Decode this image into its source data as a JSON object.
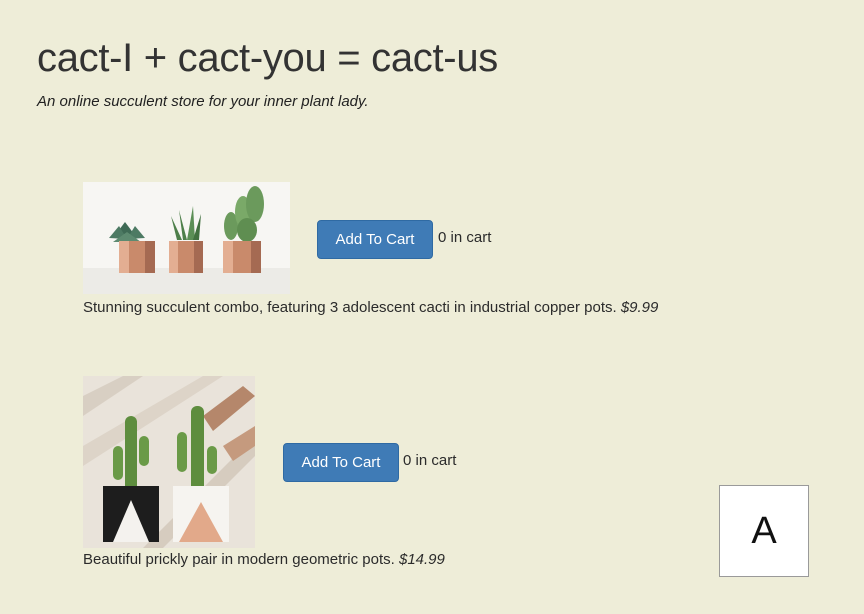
{
  "header": {
    "title": "cact-I + cact-you = cact-us",
    "tagline": "An online succulent store for your inner plant lady."
  },
  "products": [
    {
      "image_icon": "three-cacti-copper-pots-image",
      "button_label": "Add To Cart",
      "cart_count": "0 in cart",
      "description": "Stunning succulent combo, featuring 3 adolescent cacti in industrial copper pots.",
      "price": "$9.99"
    },
    {
      "image_icon": "two-cacti-geometric-pots-image",
      "button_label": "Add To Cart",
      "cart_count": "0 in cart",
      "description": "Beautiful prickly pair in modern geometric pots.",
      "price": "$14.99"
    }
  ],
  "corner_box": {
    "letter": "A"
  },
  "colors": {
    "background": "#eeedd8",
    "button": "#3f7bb6",
    "button_text": "#ffffff"
  }
}
